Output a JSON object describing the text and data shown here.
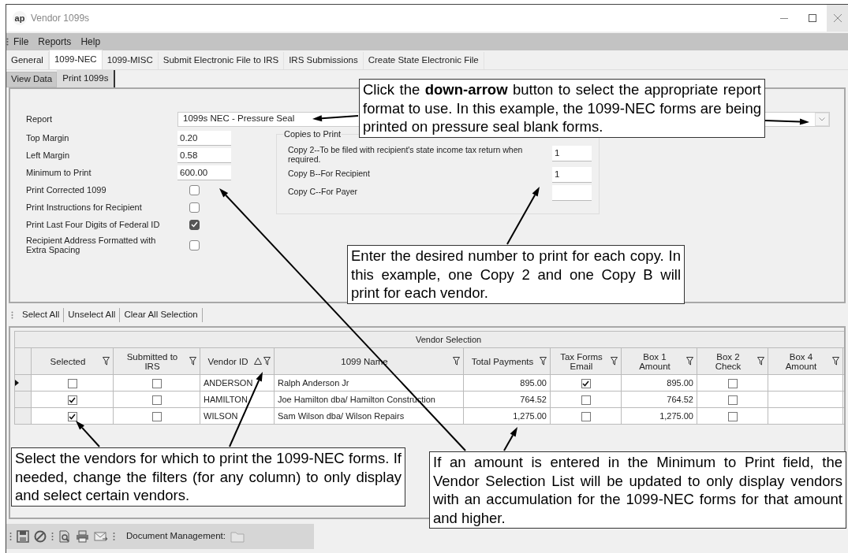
{
  "window": {
    "logo": "ap",
    "title": "Vendor 1099s"
  },
  "menu": [
    "File",
    "Reports",
    "Help"
  ],
  "tabs": [
    {
      "label": "General",
      "selected": false
    },
    {
      "label": "1099-NEC",
      "selected": true
    },
    {
      "label": "1099-MISC",
      "selected": false
    },
    {
      "label": "Submit Electronic File to IRS",
      "selected": false
    },
    {
      "label": "IRS Submissions",
      "selected": false
    },
    {
      "label": "Create State Electronic File",
      "selected": false
    }
  ],
  "subtabs": [
    {
      "label": "View Data",
      "selected": false
    },
    {
      "label": "Print 1099s",
      "selected": true
    }
  ],
  "form": {
    "report": {
      "label": "Report",
      "value": "1099s NEC - Pressure Seal"
    },
    "fields": [
      {
        "label": "Top Margin",
        "value": "0.20"
      },
      {
        "label": "Left Margin",
        "value": "0.58"
      },
      {
        "label": "Minimum to Print",
        "value": "600.00"
      }
    ],
    "checkboxes": [
      {
        "label": "Print Corrected 1099",
        "checked": false
      },
      {
        "label": "Print Instructions for Recipient",
        "checked": false
      },
      {
        "label": "Print Last Four Digits of Federal ID",
        "checked": true
      },
      {
        "label": "Recipient Address Formatted with Extra Spacing",
        "checked": false
      }
    ],
    "copies": {
      "title": "Copies to Print",
      "items": [
        {
          "label": "Copy 2--To be filed with recipient's state income tax return when required.",
          "value": "1"
        },
        {
          "label": "Copy B--For Recipient",
          "value": "1"
        },
        {
          "label": "Copy C--For Payer"
        }
      ]
    }
  },
  "grid_toolbar": [
    "Select All",
    "Unselect All",
    "Clear All Selection"
  ],
  "grid": {
    "title": "Vendor Selection",
    "columns": [
      {
        "label": "Selected",
        "kind": "check"
      },
      {
        "label": "Submitted to IRS",
        "kind": "check"
      },
      {
        "label": "Vendor ID",
        "kind": "text",
        "sort_ascending": true
      },
      {
        "label": "1099 Name",
        "kind": "text"
      },
      {
        "label": "Total Payments",
        "kind": "number"
      },
      {
        "label": "Tax Forms Email",
        "kind": "check"
      },
      {
        "label": "Box 1 Amount",
        "kind": "number"
      },
      {
        "label": "Box 2 Check",
        "kind": "check"
      },
      {
        "label": "Box 4 Amount",
        "kind": "number"
      }
    ],
    "rows": [
      {
        "current": true,
        "cells": [
          {
            "checked": false
          },
          {
            "checked": false
          },
          "ANDERSON",
          "Ralph Anderson Jr",
          "895.00",
          {
            "checked": true
          },
          "895.00",
          {
            "checked": false
          },
          null
        ]
      },
      {
        "current": false,
        "cells": [
          {
            "checked": true
          },
          {
            "checked": false
          },
          "HAMILTON",
          "Joe Hamilton dba/ Hamilton Construction",
          "764.52",
          {
            "checked": false
          },
          "764.52",
          {
            "checked": false
          },
          null
        ]
      },
      {
        "current": false,
        "cells": [
          {
            "checked": true
          },
          {
            "checked": false
          },
          "WILSON",
          "Sam Wilson dba/ Wilson Repairs",
          "1,275.00",
          {
            "checked": false
          },
          "1,275.00",
          {
            "checked": false
          },
          null
        ]
      }
    ]
  },
  "bottom_toolbar": {
    "document_management": "Document Management:"
  },
  "callouts": [
    "Click the **down-arrow** button to select the appropriate report format to use.  In this example, the 1099-NEC forms are being printed on pressure seal blank forms.",
    "Enter the desired number to print for each copy.  In this example, one Copy 2 and one Copy B will print for each vendor.",
    "Select the vendors for which to print the 1099-NEC forms.  If needed, change the filters (for any column) to only display and select certain vendors.",
    "If an amount is entered in the Minimum to Print field, the Vendor Selection List will be updated to only display vendors with an accumulation for the 1099-NEC forms for that amount and higher."
  ]
}
